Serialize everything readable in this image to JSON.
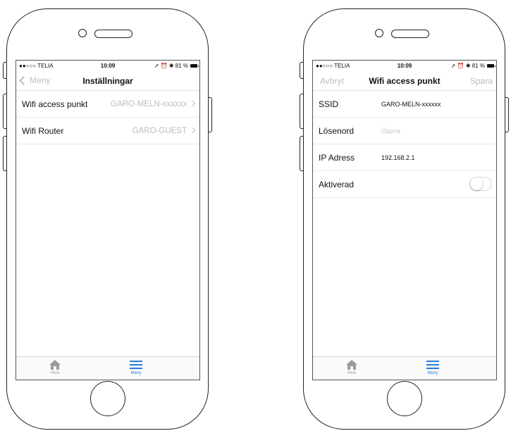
{
  "status_bar": {
    "carrier": "●●○○○ TELIA",
    "time": "10:09",
    "indicators": "81 %"
  },
  "left_screen": {
    "nav": {
      "back_label": "Meny",
      "title": "Inställningar"
    },
    "rows": [
      {
        "label": "Wifi access punkt",
        "value": "GARO-MELN-xxxxxx"
      },
      {
        "label": "Wifi Router",
        "value": "GARO-GUEST"
      }
    ]
  },
  "right_screen": {
    "nav": {
      "cancel_label": "Avbryt",
      "title": "Wifi access punkt",
      "save_label": "Spara"
    },
    "fields": {
      "ssid": {
        "label": "SSID",
        "value": "GARO-MELN-xxxxxx"
      },
      "password": {
        "label": "Lösenord",
        "placeholder": "Öppna"
      },
      "ip": {
        "label": "IP Adress",
        "value": "192.168.2.1"
      },
      "enabled": {
        "label": "Aktiverad",
        "on": false
      }
    }
  },
  "tab_bar": {
    "home_label": "Hem",
    "menu_label": "Meny",
    "home_icon": "house-icon",
    "menu_icon": "hamburger-icon",
    "active_tab": "Meny"
  },
  "colors": {
    "accent": "#2a7bd8",
    "muted_text": "#b9bcc2"
  }
}
